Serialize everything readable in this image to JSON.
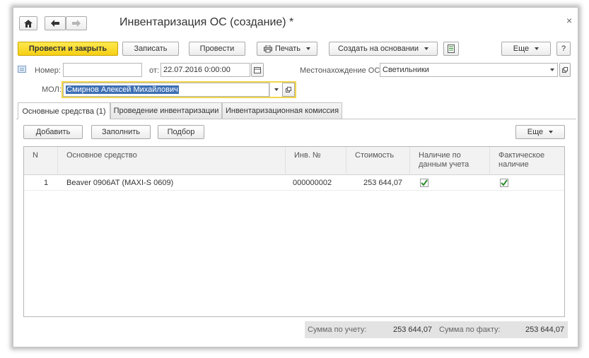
{
  "window": {
    "title": "Инвентаризация ОС (создание) *",
    "close_glyph": "×"
  },
  "toolbar": {
    "post_close": "Провести и закрыть",
    "save": "Записать",
    "post": "Провести",
    "print": "Печать",
    "create_based": "Создать на основании",
    "more": "Еще",
    "help": "?"
  },
  "form": {
    "number_label": "Номер:",
    "number_value": "",
    "date_label": "от:",
    "date_value": "22.07.2016  0:00:00",
    "location_label": "Местонахождение ОС:",
    "location_value": "Светильники",
    "mol_label": "МОЛ:",
    "mol_value": "Смирнов Алексей Михайлович"
  },
  "tabs": [
    {
      "label": "Основные средства (1)",
      "active": true
    },
    {
      "label": "Проведение инвентаризации",
      "active": false
    },
    {
      "label": "Инвентаризационная комиссия",
      "active": false
    }
  ],
  "table_toolbar": {
    "add": "Добавить",
    "fill": "Заполнить",
    "select": "Подбор",
    "more": "Еще"
  },
  "table": {
    "columns": [
      "N",
      "Основное средство",
      "Инв. №",
      "Стоимость",
      "Наличие по\nданным учета",
      "Фактическое\nналичие"
    ],
    "rows": [
      {
        "n": "1",
        "asset": "Beaver 0906AT (MAXI-S 0609)",
        "inv": "000000002",
        "cost": "253 644,07",
        "by_records": true,
        "actual": true
      }
    ]
  },
  "footer": {
    "sum_records_label": "Сумма по учету:",
    "sum_records_value": "253 644,07",
    "sum_actual_label": "Сумма по факту:",
    "sum_actual_value": "253 644,07"
  },
  "colors": {
    "accent_yellow": "#f5cf13",
    "selection": "#3d6fb4",
    "check_green": "#2e8b2e"
  }
}
